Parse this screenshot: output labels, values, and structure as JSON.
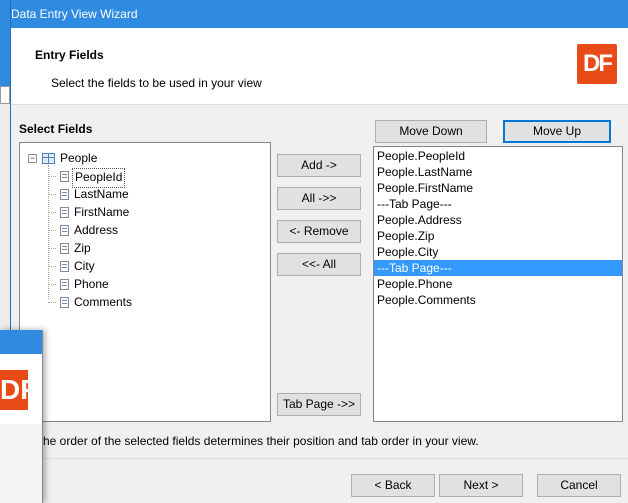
{
  "window": {
    "title": "Data Entry View Wizard",
    "accent_color": "#2f8be0",
    "logo_text": "DF",
    "logo_color": "#e84a18"
  },
  "header": {
    "title": "Entry Fields",
    "subtitle": "Select the fields to be used in your view"
  },
  "left_panel": {
    "label": "Select Fields",
    "tree": {
      "root_label": "People",
      "root_icon": "table-icon",
      "expanded": true,
      "expander_glyph": "−",
      "fields": [
        "PeopleId",
        "LastName",
        "FirstName",
        "Address",
        "Zip",
        "City",
        "Phone",
        "Comments"
      ],
      "selected_field": "PeopleId"
    }
  },
  "buttons": {
    "move_down": "Move Down",
    "move_up": "Move Up",
    "add": "Add ->",
    "all": "All ->>",
    "remove": "<- Remove",
    "remove_all": "<<- All",
    "tab_page": "Tab Page ->>"
  },
  "selected_list": {
    "items": [
      "People.PeopleId",
      "People.LastName",
      "People.FirstName",
      "---Tab Page---",
      "People.Address",
      "People.Zip",
      "People.City",
      "---Tab Page---",
      "People.Phone",
      "People.Comments"
    ],
    "selected_index": 7,
    "selection_color": "#3399ff"
  },
  "footer": {
    "note": "he order of the selected fields determines their position and tab order in your view.",
    "back": "< Back",
    "next": "Next >",
    "cancel": "Cancel"
  }
}
